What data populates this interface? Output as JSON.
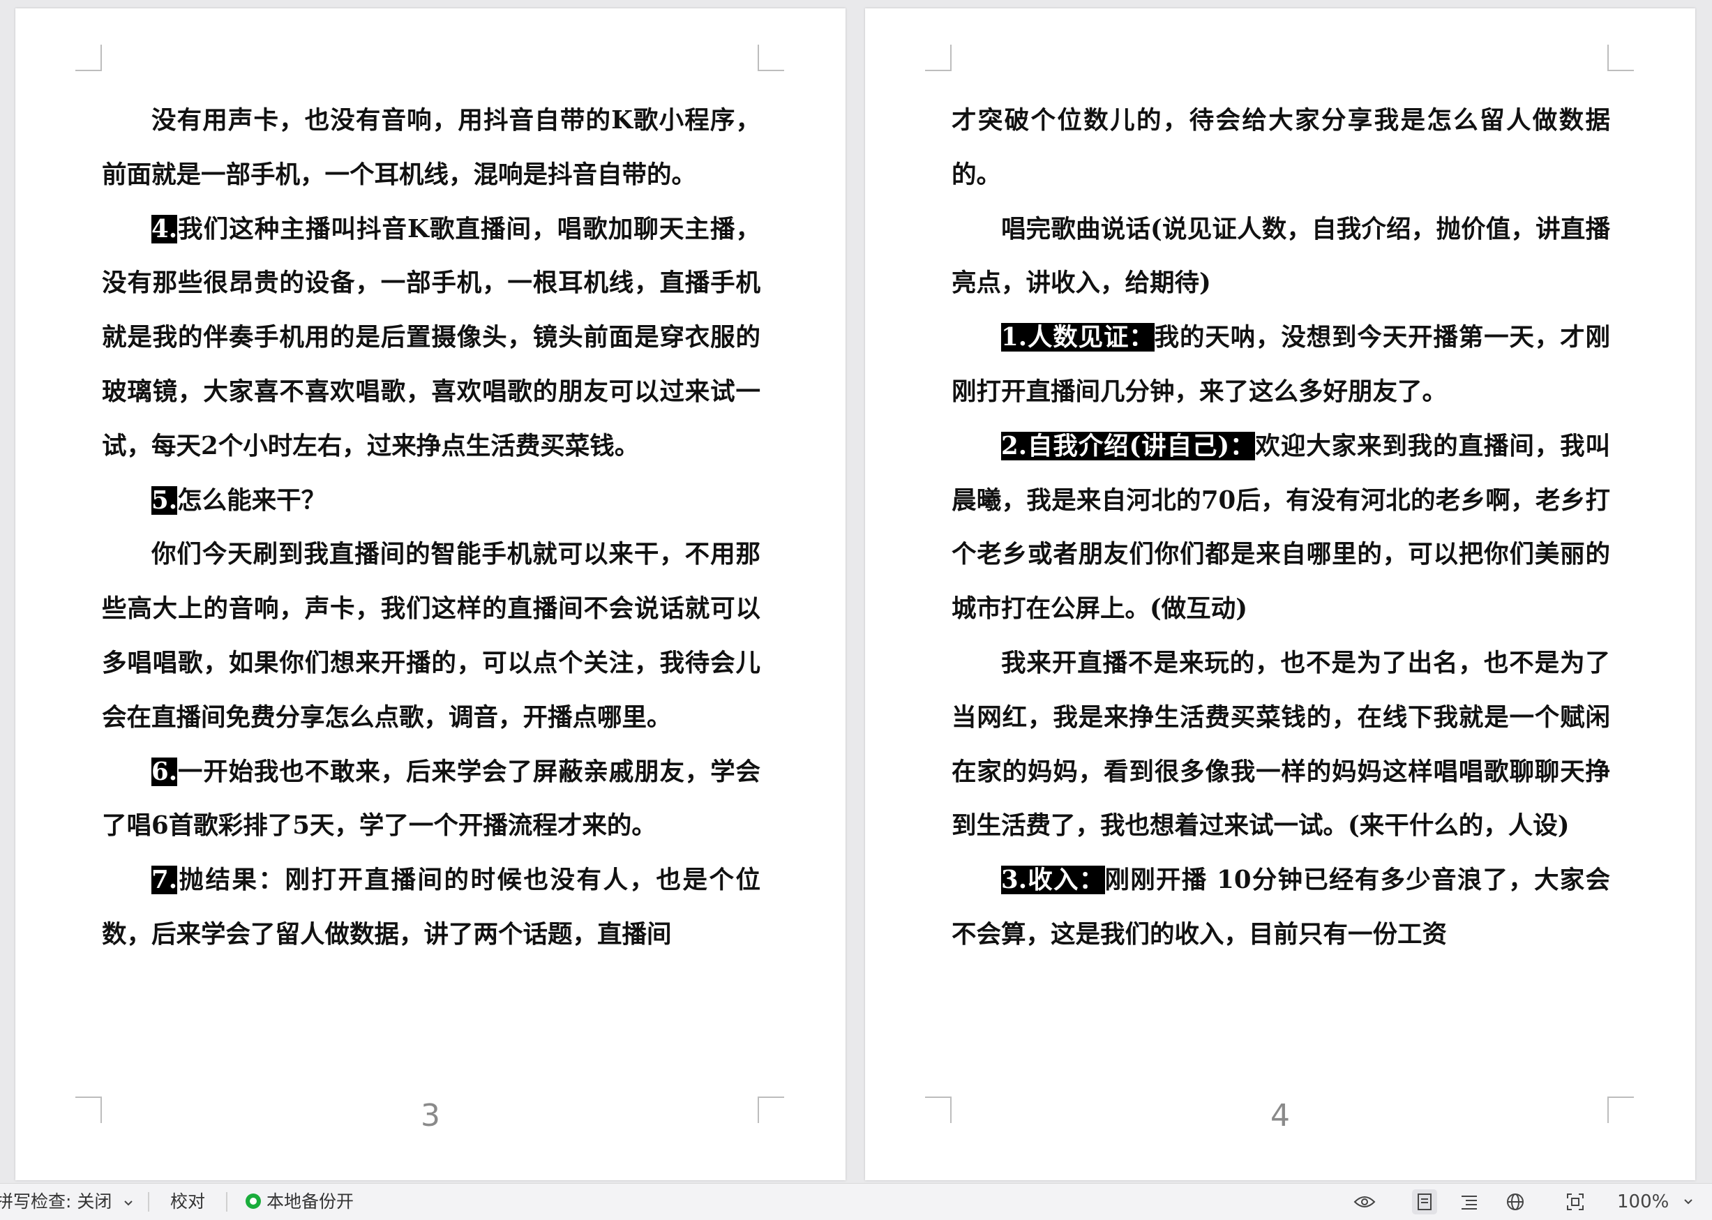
{
  "pages": [
    {
      "number": "3",
      "paragraphs": [
        {
          "indent": true,
          "prefix": "",
          "text": "没有用声卡，也没有音响，用抖音自带的K歌小程序，前面就是一部手机，一个耳机线，混响是抖音自带的。"
        },
        {
          "indent": true,
          "prefix": "4.",
          "text": "我们这种主播叫抖音K歌直播间，唱歌加聊天主播，没有那些很昂贵的设备，一部手机，一根耳机线，直播手机就是我的伴奏手机用的是后置摄像头，镜头前面是穿衣服的玻璃镜，大家喜不喜欢唱歌，喜欢唱歌的朋友可以过来试一试，每天2个小时左右，过来挣点生活费买菜钱。"
        },
        {
          "indent": true,
          "prefix": "5.",
          "text": "怎么能来干？"
        },
        {
          "indent": true,
          "prefix": "",
          "text": "你们今天刷到我直播间的智能手机就可以来干，不用那些高大上的音响，声卡，我们这样的直播间不会说话就可以多唱唱歌，如果你们想来开播的，可以点个关注，我待会儿会在直播间免费分享怎么点歌，调音，开播点哪里。"
        },
        {
          "indent": true,
          "prefix": "6.",
          "text": "一开始我也不敢来，后来学会了屏蔽亲戚朋友，学会了唱6首歌彩排了5天，学了一个开播流程才来的。"
        },
        {
          "indent": true,
          "prefix": "7.",
          "text": "抛结果：刚打开直播间的时候也没有人，也是个位数，后来学会了留人做数据，讲了两个话题，直播间"
        }
      ]
    },
    {
      "number": "4",
      "paragraphs": [
        {
          "indent": false,
          "prefix": "",
          "text": "才突破个位数儿的，待会给大家分享我是怎么留人做数据的。"
        },
        {
          "indent": true,
          "prefix": "",
          "text": "唱完歌曲说话(说见证人数，自我介绍，抛价值，讲直播亮点，讲收入，给期待)"
        },
        {
          "indent": true,
          "prefix": "1.人数见证：",
          "text": "我的天呐，没想到今天开播第一天，才刚刚打开直播间几分钟，来了这么多好朋友了。"
        },
        {
          "indent": true,
          "prefix": "2.自我介绍(讲自己)：",
          "text": "欢迎大家来到我的直播间，我叫晨曦，我是来自河北的70后，有没有河北的老乡啊，老乡打个老乡或者朋友们你们都是来自哪里的，可以把你们美丽的城市打在公屏上。(做互动)"
        },
        {
          "indent": true,
          "prefix": "",
          "text": "我来开直播不是来玩的，也不是为了出名，也不是为了当网红，我是来挣生活费买菜钱的，在线下我就是一个赋闲在家的妈妈，看到很多像我一样的妈妈这样唱唱歌聊聊天挣到生活费了，我也想着过来试一试。(来干什么的，人设)"
        },
        {
          "indent": true,
          "prefix": "3.收入：",
          "text": "刚刚开播 10分钟已经有多少音浪了，大家会不会算，这是我们的收入，目前只有一份工资"
        }
      ]
    }
  ],
  "statusbar": {
    "spellcheck": "拼写检查: 关闭",
    "proofread": "校对",
    "backup": "本地备份开",
    "zoom": "100%",
    "backup_color": "#1aad3c"
  },
  "icons": [
    "chevron-down-icon",
    "eye-icon",
    "page-view-icon",
    "outline-view-icon",
    "web-view-icon",
    "fit-page-icon",
    "chevron-down-icon"
  ]
}
